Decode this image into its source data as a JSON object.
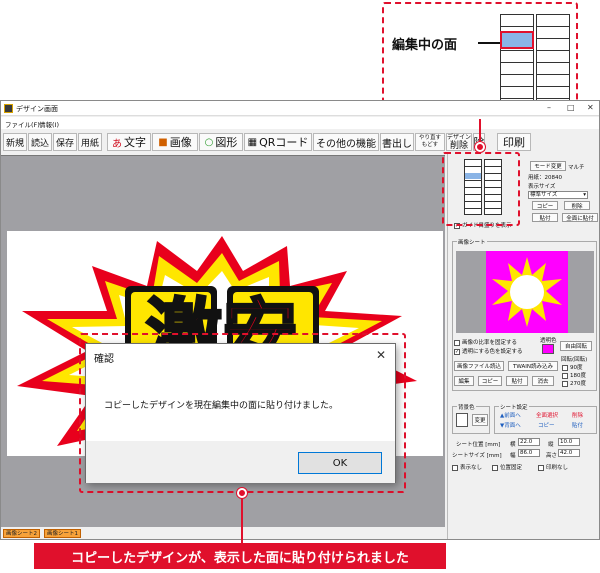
{
  "callout": {
    "label": "編集中の面"
  },
  "window": {
    "title": "デザイン画面",
    "menu": [
      "ファイル(F)",
      "情報(I)"
    ],
    "toolbar": {
      "new": "新規",
      "open": "読込",
      "save": "保存",
      "paper": "用紙",
      "text": "文字",
      "image": "画像",
      "shape": "図形",
      "qr": "QRコード",
      "other": "その他の機能",
      "export": "書出し",
      "redo_top": "やり直す",
      "redo_bottom": "もどす",
      "design_top": "デザイン",
      "design_bottom": "削除",
      "print": "印刷",
      "mid_glyph": "除"
    },
    "text_icon": "あ"
  },
  "right_panel": {
    "guide_checkbox": "ガイド目盛りを表示",
    "mode_change": "モード変更",
    "mode_value": "マルチ",
    "paper_label": "用紙：20840",
    "display_size_label": "表示サイズ",
    "display_size_value": "標準サイズ",
    "copy": "コピー",
    "delete": "削除",
    "paste": "貼付",
    "paste_all": "全面に貼付",
    "image_sheet_label": "画像シート",
    "keep_ratio": "画像の比率を固定する",
    "transparent_color": "透明にする色を設定する",
    "transparent_label": "透明色",
    "free_rotate": "自由回転",
    "rotate_header": "回転(回転)",
    "rotate_90": "90度",
    "rotate_180": "180度",
    "rotate_270": "270度",
    "image_file_load": "画像ファイル読込",
    "twain": "TWAIN読み込み",
    "img_edit": "編集",
    "img_copy": "コピー",
    "img_paste": "貼付",
    "img_erase": "消去",
    "bg_color_label": "背景色",
    "bg_change": "変更",
    "sheet_settings_label": "シート設定",
    "front": "▲前面へ",
    "back": "▼背面へ",
    "all_select": "全面選択",
    "sheet_copy": "コピー",
    "sheet_delete": "削除",
    "sheet_paste": "貼付",
    "sheet_position_label": "シート位置 [mm]",
    "width_label": "横",
    "width_value": "22.0",
    "vertical_label": "縦",
    "vertical_value": "10.0",
    "sheet_size_label": "シートサイズ [mm]",
    "size_w_label": "幅",
    "size_w_value": "86.0",
    "size_h_label": "高さ",
    "size_h_value": "42.0",
    "hide": "表示なし",
    "fix_position": "位置固定",
    "no_print": "印刷なし"
  },
  "tabs": [
    "画像シート2",
    "画像シート1"
  ],
  "dialog": {
    "title": "確認",
    "message": "コピーしたデザインを現在編集中の面に貼り付けました。",
    "ok": "OK"
  },
  "artwork": {
    "text": "激安"
  },
  "caption": "コピーしたデザインが、表示した面に貼り付けられました",
  "colors": {
    "accent_red": "#e0102c",
    "burst_yellow": "#ffe600",
    "burst_red": "#e8001c",
    "magenta": "#ff00ff",
    "selected_face": "#8ab4e6"
  }
}
